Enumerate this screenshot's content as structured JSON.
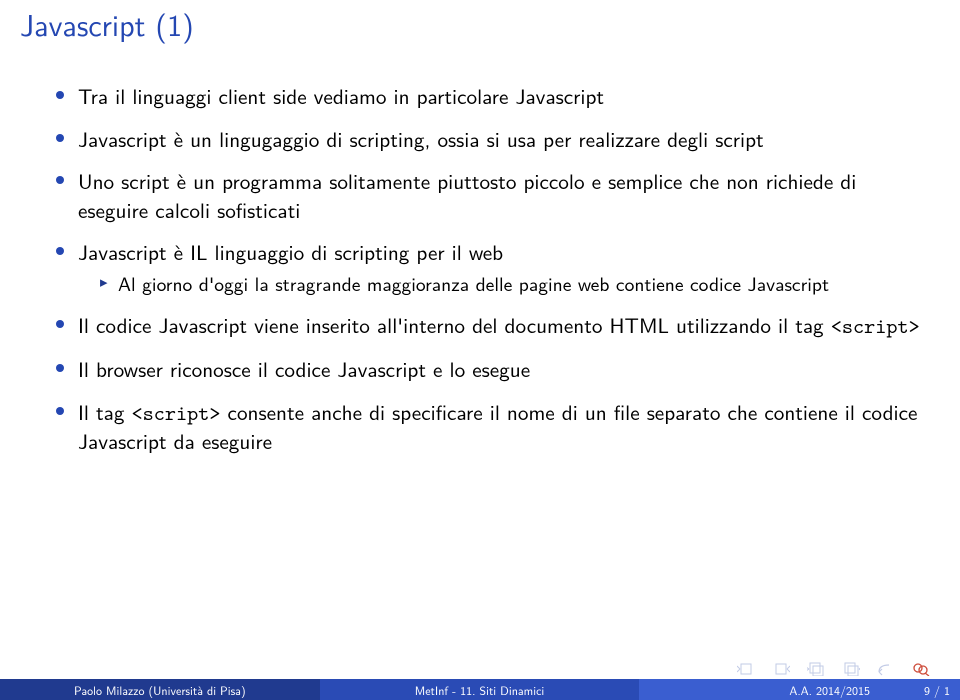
{
  "title": "Javascript (1)",
  "bullets": [
    {
      "text": "Tra il linguaggi client side vediamo in particolare Javascript"
    },
    {
      "text": "Javascript è un lingugaggio di scripting, ossia si usa per realizzare degli script"
    },
    {
      "text": "Uno script è un programma solitamente piuttosto piccolo e semplice che non richiede di eseguire calcoli sofisticati"
    },
    {
      "text": "Javascript è IL linguaggio di scripting per il web",
      "sub": [
        "Al giorno d'oggi la stragrande maggioranza delle pagine web contiene codice Javascript"
      ]
    },
    {
      "text_pre": "Il codice Javascript viene inserito all'interno del documento HTML utilizzando il tag ",
      "code": "<script>"
    },
    {
      "text": "Il browser riconosce il codice Javascript e lo esegue"
    },
    {
      "text_pre": "Il tag ",
      "code": "<script>",
      "text_post": " consente anche di specificare il nome di un file separato che contiene il codice Javascript da eseguire"
    }
  ],
  "footer": {
    "left": "Paolo Milazzo (Università di Pisa)",
    "mid": "MetInf - 11. Siti Dinamici",
    "right": "A.A. 2014/2015",
    "page": "9 / 1"
  }
}
